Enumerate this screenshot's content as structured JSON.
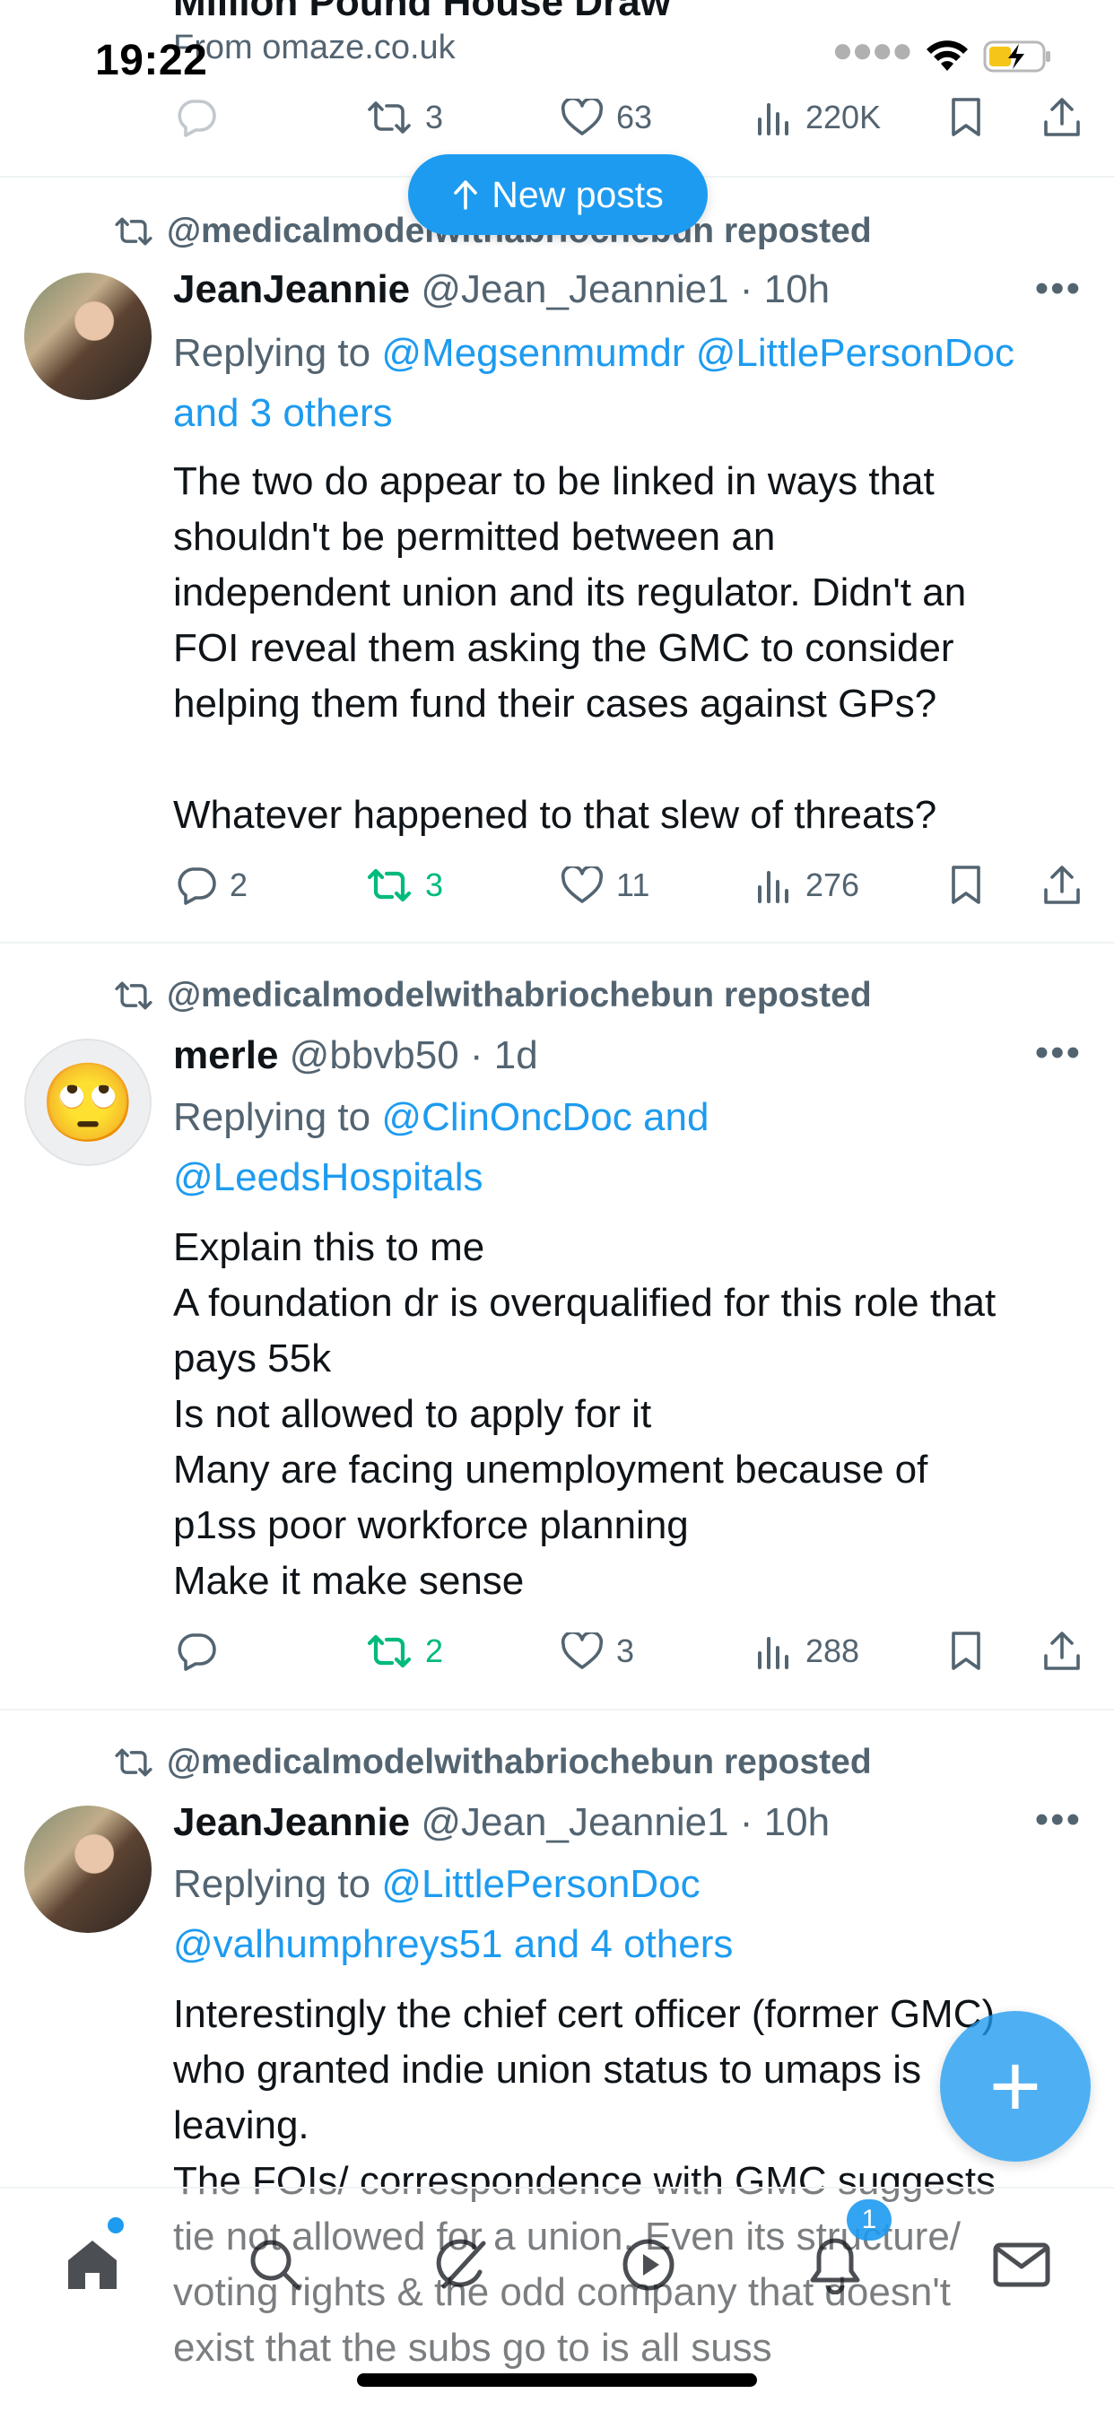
{
  "status_bar": {
    "time": "19:22"
  },
  "top_partial": {
    "title": "Million Pound House Draw",
    "from": "From omaze.co.uk",
    "stats": {
      "replies": "",
      "reposts": "3",
      "likes": "63",
      "views": "220K"
    }
  },
  "new_posts_label": "New posts",
  "tweets": [
    {
      "reposted_by": "@medicalmodelwithabriochebun reposted",
      "display_name": "JeanJeannie",
      "handle_time": "@Jean_Jeannie1 · 10h",
      "replying_prefix": "Replying to",
      "reply_line1_mentions": "@Megsenmumdr @LittlePersonDoc",
      "reply_line2": "and 3 others",
      "body_lines": [
        "The two do appear to be linked in ways that",
        "shouldn't be permitted between an",
        "independent union and its regulator. Didn't an",
        "FOI reveal them asking the GMC to consider",
        "helping them fund their cases against GPs?",
        "",
        "Whatever happened to that slew of threats?"
      ],
      "stats": {
        "replies": "2",
        "reposts": "3",
        "likes": "11",
        "views": "276"
      }
    },
    {
      "reposted_by": "@medicalmodelwithabriochebun reposted",
      "display_name": "merle",
      "handle_time": "@bbvb50 · 1d",
      "avatar_emoji": "🙄",
      "replying_prefix": "Replying to",
      "reply_line1_mentions": "@ClinOncDoc and",
      "reply_line2": "@LeedsHospitals",
      "body_lines": [
        "Explain this to me",
        "A foundation dr is overqualified for this role that",
        "pays 55k",
        "Is not allowed to apply for it",
        "Many are facing unemployment because of",
        "p1ss poor workforce planning",
        "Make it make sense"
      ],
      "stats": {
        "replies": "",
        "reposts": "2",
        "likes": "3",
        "views": "288"
      }
    },
    {
      "reposted_by": "@medicalmodelwithabriochebun reposted",
      "display_name": "JeanJeannie",
      "handle_time": "@Jean_Jeannie1 · 10h",
      "replying_prefix": "Replying to",
      "reply_line1_mentions": "@LittlePersonDoc",
      "reply_line2": "@valhumphreys51 and 4 others",
      "body_lines": [
        "Interestingly the chief cert officer (former GMC)",
        "who granted indie union status to umaps is",
        "leaving.",
        "The FOIs/ correspondence with GMC suggests",
        "tie not allowed for a union. Even its structure/",
        "voting rights & the odd company that doesn't",
        "exist that the subs go to is all suss"
      ]
    }
  ],
  "bottom_nav": {
    "items": [
      "home-icon",
      "search-icon",
      "grok-icon",
      "play-icon",
      "bell-icon",
      "mail-icon"
    ],
    "notifications_badge": "1"
  },
  "colors": {
    "accent": "#1d9bf0",
    "repost_green": "#00ba7c",
    "secondary_text": "#536471",
    "primary_text": "#0f1419"
  }
}
